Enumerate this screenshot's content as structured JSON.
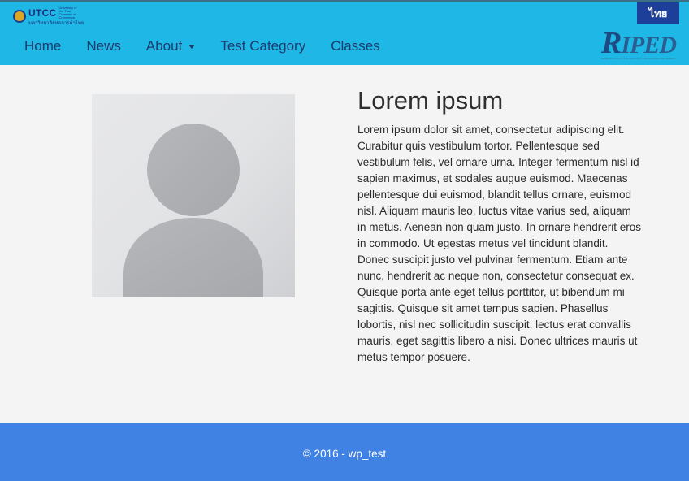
{
  "header": {
    "logo_left": {
      "name": "UTCC",
      "subtitle_en": "University of the Thai Chamber of Commerce",
      "subtitle_th": "มหาวิทยาลัยหอการค้าไทย"
    },
    "language_button": "ไทย",
    "nav": [
      {
        "label": "Home"
      },
      {
        "label": "News"
      },
      {
        "label": "About",
        "has_dropdown": true
      },
      {
        "label": "Test Category"
      },
      {
        "label": "Classes"
      }
    ],
    "logo_right": {
      "first_letter": "R",
      "rest": "IPED",
      "tagline": "RESEARCH INSTITUTE FOR POLICY EVALUATION AND DESIGN"
    }
  },
  "main": {
    "title": "Lorem ipsum",
    "body": "Lorem ipsum dolor sit amet, consectetur adipiscing elit. Curabitur quis vestibulum tortor. Pellentesque sed vestibulum felis, vel ornare urna. Integer fermentum nisl id sapien maximus, et sodales augue euismod. Maecenas pellentesque dui euismod, blandit tellus ornare, euismod nisl. Aliquam mauris leo, luctus vitae varius sed, aliquam in metus. Aenean non quam justo. In ornare hendrerit eros in commodo. Ut egestas metus vel tincidunt blandit. Donec suscipit justo vel pulvinar fermentum. Etiam ante nunc, hendrerit ac neque non, consectetur consequat ex. Quisque porta ante eget tellus porttitor, ut bibendum mi sagittis. Quisque sit amet tempus sapien. Phasellus lobortis, nisl nec sollicitudin suscipit, lectus erat convallis mauris, eget sagittis libero a nisi. Donec ultrices mauris ut metus tempor posuere.",
    "avatar_icon": "person-placeholder-icon"
  },
  "footer": {
    "text": "© 2016 - wp_test"
  },
  "colors": {
    "header_bg": "#1fb8e6",
    "nav_text": "#1b3b6b",
    "lang_button_bg": "#1d3f99",
    "footer_bg": "#3f82e4",
    "page_bg": "#f4f4f4"
  }
}
